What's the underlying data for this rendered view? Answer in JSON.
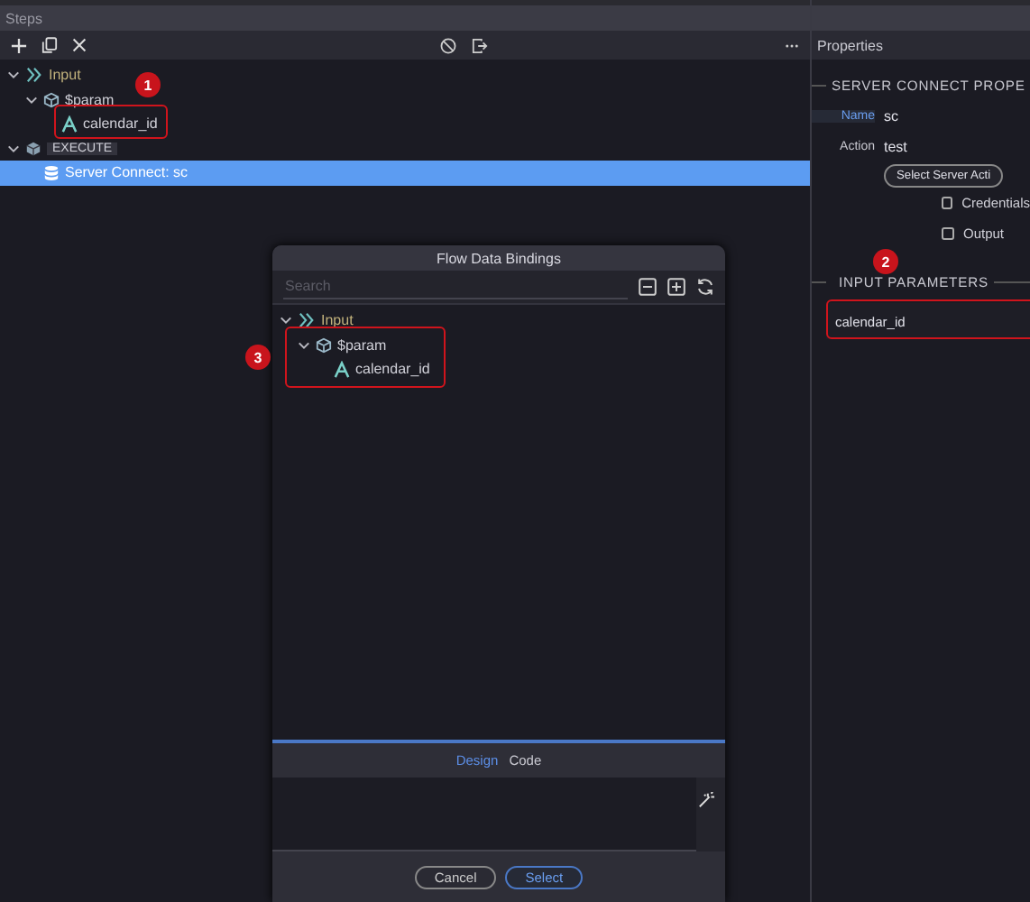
{
  "steps_panel": {
    "title": "Steps",
    "tree": [
      {
        "label": "Input",
        "kind": "input",
        "expanded": true,
        "children": [
          {
            "label": "$param",
            "kind": "object",
            "expanded": true,
            "children": [
              {
                "label": "calendar_id",
                "kind": "text",
                "selected": false
              }
            ]
          }
        ]
      },
      {
        "label": "EXECUTE",
        "kind": "execute",
        "expanded": true,
        "children": [
          {
            "label": "Server Connect: sc",
            "kind": "server",
            "selected": true
          }
        ]
      }
    ]
  },
  "properties_panel": {
    "title": "Properties",
    "section": "SERVER CONNECT PROPE",
    "fields": [
      {
        "label": "Name",
        "value": "sc",
        "highlighted": true
      },
      {
        "label": "Action",
        "value": "test",
        "highlighted": false
      }
    ],
    "action_button": "Select Server Acti",
    "checkboxes": [
      {
        "label": "Credentials",
        "checked": false
      },
      {
        "label": "Output",
        "checked": false
      }
    ],
    "input_section": "INPUT PARAMETERS",
    "input_parameters": [
      {
        "value": "calendar_id"
      }
    ]
  },
  "dialog": {
    "title": "Flow Data Bindings",
    "search": {
      "placeholder": "Search"
    },
    "tree": [
      {
        "label": "Input",
        "kind": "input",
        "expanded": true,
        "children": [
          {
            "label": "$param",
            "kind": "object",
            "expanded": true,
            "children": [
              {
                "label": "calendar_id",
                "kind": "text",
                "selected": false
              }
            ]
          }
        ]
      }
    ],
    "tabs": [
      {
        "label": "Design",
        "selected": true
      },
      {
        "label": "Code",
        "selected": false
      }
    ],
    "buttons": [
      {
        "label": "Cancel",
        "kind": "secondary"
      },
      {
        "label": "Select",
        "kind": "primary"
      }
    ]
  },
  "annotations": [
    {
      "label": "1"
    },
    {
      "label": "2"
    },
    {
      "label": "3"
    }
  ]
}
